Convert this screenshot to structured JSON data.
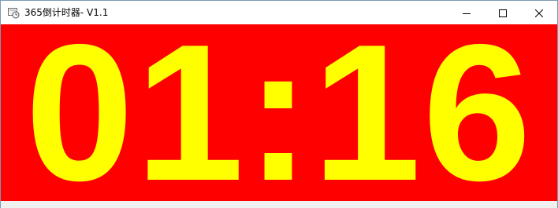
{
  "window": {
    "title": "365倒计时器- V1.1",
    "app_icon": "clock-app-icon"
  },
  "caption_buttons": {
    "minimize_icon": "minimize-icon",
    "maximize_icon": "maximize-icon",
    "close_icon": "close-icon"
  },
  "timer": {
    "display": "01:16"
  },
  "colors": {
    "background": "#ff0000",
    "digits": "#ffff00"
  }
}
